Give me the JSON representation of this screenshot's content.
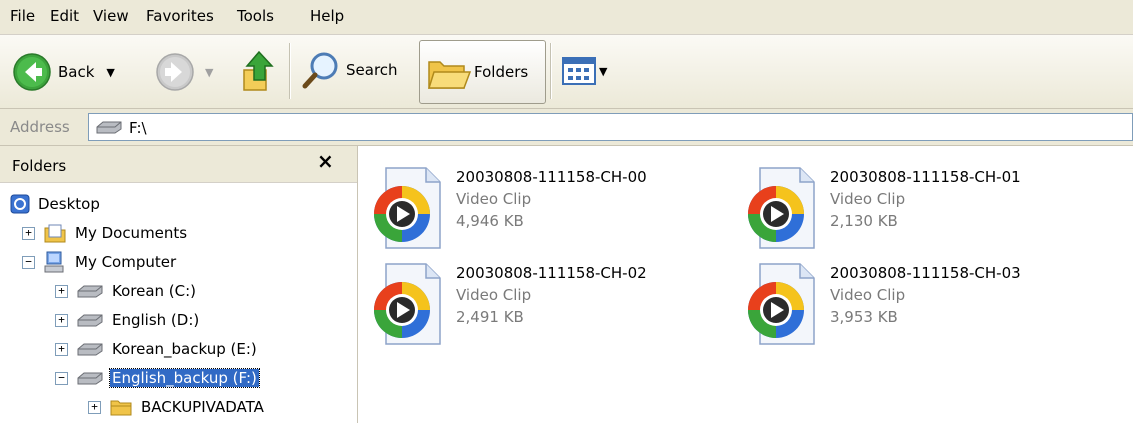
{
  "menu": [
    "File",
    "Edit",
    "View",
    "Favorites",
    "Tools",
    "Help"
  ],
  "toolbar": {
    "back_label": "Back",
    "search_label": "Search",
    "folders_label": "Folders"
  },
  "address": {
    "label": "Address",
    "value": "F:\\"
  },
  "folders_pane": {
    "title": "Folders",
    "close": "×",
    "tree": [
      {
        "label": "Desktop",
        "expander": "",
        "icon": "desktop-icon"
      },
      {
        "label": "My Documents",
        "expander": "+",
        "icon": "my-documents-icon"
      },
      {
        "label": "My Computer",
        "expander": "−",
        "icon": "my-computer-icon"
      },
      {
        "label": "Korean (C:)",
        "expander": "+",
        "icon": "drive-icon"
      },
      {
        "label": "English (D:)",
        "expander": "+",
        "icon": "drive-icon"
      },
      {
        "label": "Korean_backup (E:)",
        "expander": "+",
        "icon": "drive-icon"
      },
      {
        "label": "English_backup (F:)",
        "expander": "−",
        "icon": "drive-icon",
        "selected": true
      },
      {
        "label": "BACKUPIVADATA",
        "expander": "+",
        "icon": "folder-icon"
      }
    ]
  },
  "files": [
    {
      "name": "20030808-111158-CH-00",
      "type": "Video Clip",
      "size": "4,946 KB"
    },
    {
      "name": "20030808-111158-CH-01",
      "type": "Video Clip",
      "size": "2,130 KB"
    },
    {
      "name": "20030808-111158-CH-02",
      "type": "Video Clip",
      "size": "2,491 KB"
    },
    {
      "name": "20030808-111158-CH-03",
      "type": "Video Clip",
      "size": "3,953 KB"
    }
  ],
  "colors": {
    "chrome": "#ece9d8",
    "selection": "#316ac5"
  }
}
